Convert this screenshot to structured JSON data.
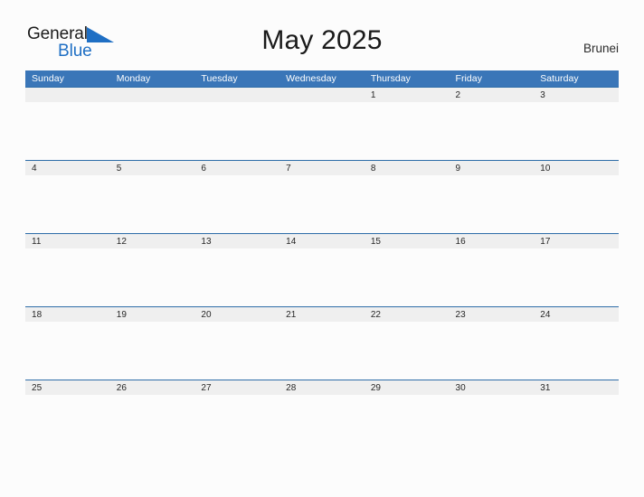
{
  "brand": {
    "word1": "General",
    "word2": "Blue",
    "flag_icon": "blue-triangle-flag",
    "word1_color": "#1c1c1c",
    "word2_color": "#1f6fc4"
  },
  "header": {
    "title": "May 2025",
    "country": "Brunei"
  },
  "colors": {
    "header_blue": "#3a76b8",
    "row_rule_blue": "#2e6da8",
    "day_strip_gray": "#efefef",
    "page_background": "#fcfcfc",
    "text_dark": "#262626"
  },
  "calendar": {
    "weekdays": [
      "Sunday",
      "Monday",
      "Tuesday",
      "Wednesday",
      "Thursday",
      "Friday",
      "Saturday"
    ],
    "weeks": [
      {
        "days": [
          {
            "label": ""
          },
          {
            "label": ""
          },
          {
            "label": ""
          },
          {
            "label": ""
          },
          {
            "label": "1"
          },
          {
            "label": "2"
          },
          {
            "label": "3"
          }
        ]
      },
      {
        "days": [
          {
            "label": "4"
          },
          {
            "label": "5"
          },
          {
            "label": "6"
          },
          {
            "label": "7"
          },
          {
            "label": "8"
          },
          {
            "label": "9"
          },
          {
            "label": "10"
          }
        ]
      },
      {
        "days": [
          {
            "label": "11"
          },
          {
            "label": "12"
          },
          {
            "label": "13"
          },
          {
            "label": "14"
          },
          {
            "label": "15"
          },
          {
            "label": "16"
          },
          {
            "label": "17"
          }
        ]
      },
      {
        "days": [
          {
            "label": "18"
          },
          {
            "label": "19"
          },
          {
            "label": "20"
          },
          {
            "label": "21"
          },
          {
            "label": "22"
          },
          {
            "label": "23"
          },
          {
            "label": "24"
          }
        ]
      },
      {
        "days": [
          {
            "label": "25"
          },
          {
            "label": "26"
          },
          {
            "label": "27"
          },
          {
            "label": "28"
          },
          {
            "label": "29"
          },
          {
            "label": "30"
          },
          {
            "label": "31"
          }
        ]
      }
    ]
  }
}
